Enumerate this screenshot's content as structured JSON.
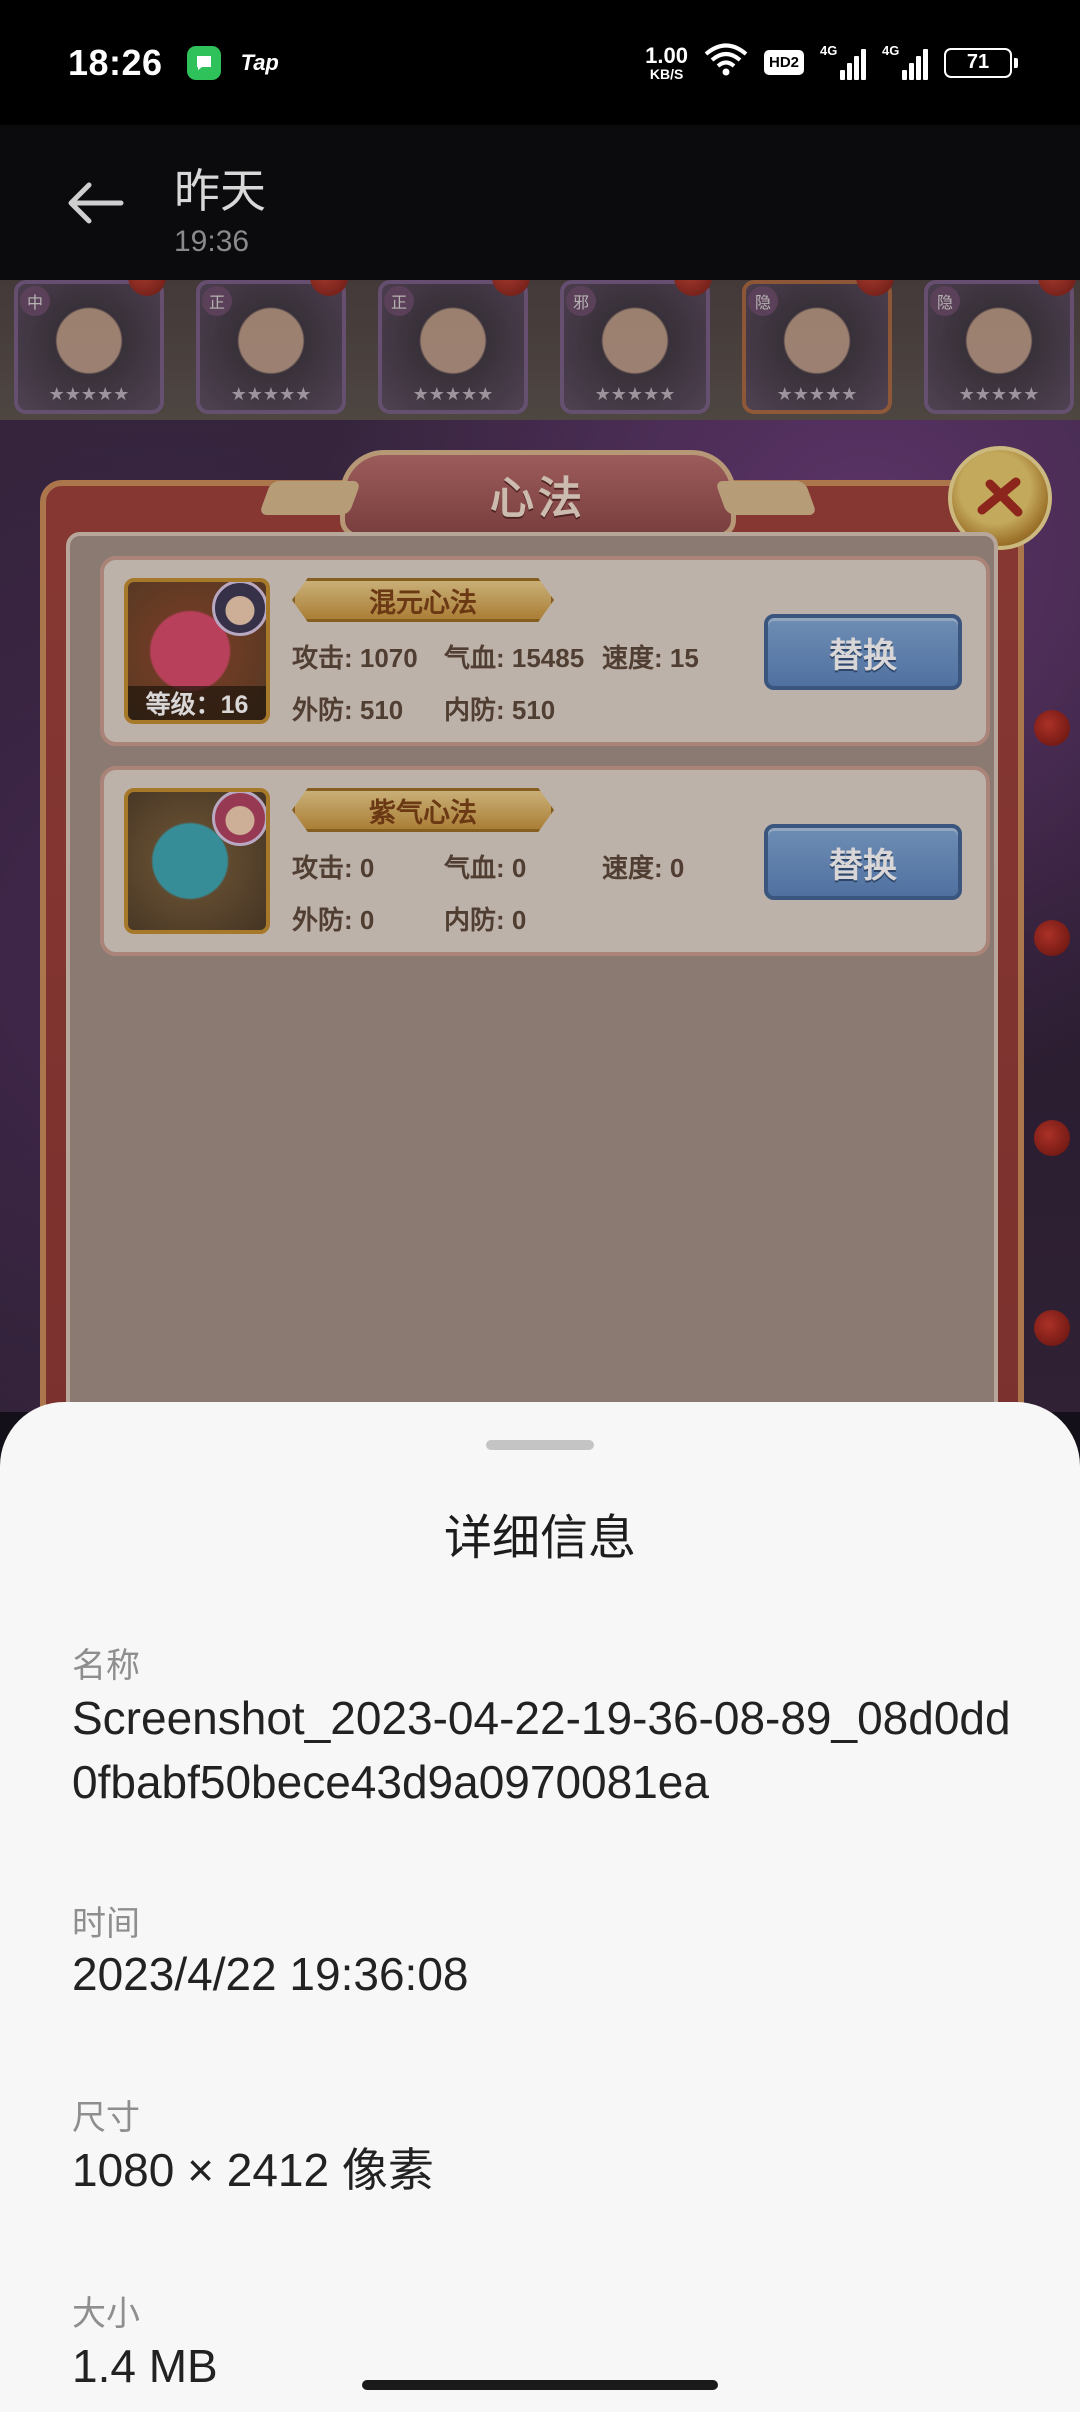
{
  "status_bar": {
    "time": "18:26",
    "app_label": "Tap",
    "net_speed": "1.00",
    "net_unit": "KB/S",
    "hd_badge": "HD2",
    "sig1_label": "4G",
    "sig2_label": "4G",
    "battery": "71"
  },
  "header": {
    "title": "昨天",
    "subtitle": "19:36"
  },
  "game": {
    "hero_factions": [
      "中",
      "正",
      "正",
      "邪",
      "隐",
      "隐"
    ],
    "panel_title": "心法",
    "manuals": [
      {
        "name": "混元心法",
        "level": "等级：16",
        "attack": "攻击: 1070",
        "hp": "气血: 15485",
        "speed": "速度: 15",
        "outer_def": "外防: 510",
        "inner_def": "内防: 510",
        "button": "替换"
      },
      {
        "name": "紫气心法",
        "attack": "攻击: 0",
        "hp": "气血: 0",
        "speed": "速度: 0",
        "outer_def": "外防: 0",
        "inner_def": "内防: 0",
        "button": "替换"
      }
    ]
  },
  "sheet": {
    "title": "详细信息",
    "name_label": "名称",
    "name_value": "Screenshot_2023-04-22-19-36-08-89_08d0dd0fbabf50bece43d9a0970081ea",
    "time_label": "时间",
    "time_value": "2023/4/22 19:36:08",
    "size_label": "尺寸",
    "size_value": "1080 × 2412 像素",
    "filesize_label": "大小",
    "filesize_value": "1.4 MB"
  },
  "icons": {
    "back": "arrow-left-icon",
    "close": "close-icon",
    "app": "message-icon",
    "wifi": "wifi-icon"
  }
}
